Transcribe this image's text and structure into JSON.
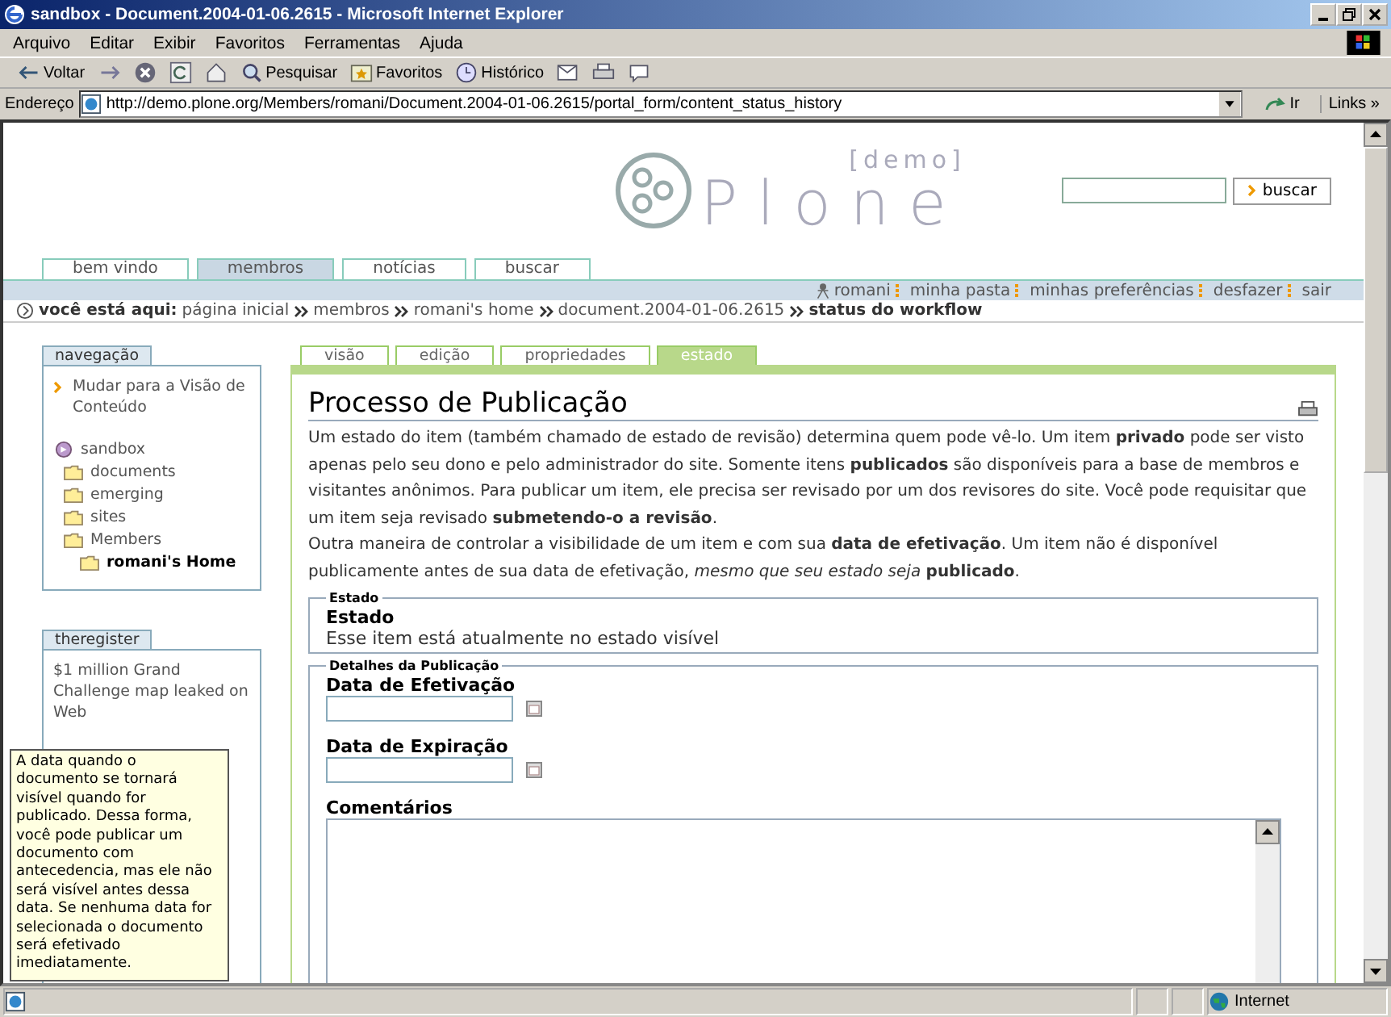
{
  "window": {
    "title": "sandbox - Document.2004-01-06.2615 - Microsoft Internet Explorer"
  },
  "menu": [
    "Arquivo",
    "Editar",
    "Exibir",
    "Favoritos",
    "Ferramentas",
    "Ajuda"
  ],
  "toolbar": [
    {
      "kind": "back",
      "label": "Voltar"
    },
    {
      "kind": "forward"
    },
    {
      "kind": "stop"
    },
    {
      "kind": "refresh"
    },
    {
      "kind": "home"
    },
    {
      "kind": "search",
      "label": "Pesquisar"
    },
    {
      "kind": "favorites",
      "label": "Favoritos"
    },
    {
      "kind": "history",
      "label": "Histórico"
    },
    {
      "kind": "mail"
    },
    {
      "kind": "print"
    },
    {
      "kind": "discuss"
    }
  ],
  "address": {
    "label": "Endereço",
    "url": "http://demo.plone.org/Members/romani/Document.2004-01-06.2615/portal_form/content_status_history",
    "go": "Ir",
    "links": "Links »"
  },
  "logo": {
    "tag": "[demo]",
    "name": "Plone"
  },
  "search": {
    "button": "buscar"
  },
  "site_tabs": [
    {
      "label": "bem vindo",
      "selected": false
    },
    {
      "label": "membros",
      "selected": true
    },
    {
      "label": "notícias",
      "selected": false
    },
    {
      "label": "buscar",
      "selected": false
    }
  ],
  "personal_bar": [
    "romani",
    "minha pasta",
    "minhas preferências",
    "desfazer",
    "sair"
  ],
  "breadcrumb": {
    "label": "você está aqui:",
    "items": [
      "página inicial",
      "membros",
      "romani's home",
      "document.2004-01-06.2615",
      "status do workflow"
    ]
  },
  "navigation": {
    "title": "navegação",
    "switch": "Mudar para a Visão de Conteúdo",
    "tree": [
      {
        "label": "sandbox",
        "kind": "root",
        "selected": false,
        "children": [
          {
            "label": "documents",
            "kind": "folder",
            "selected": false
          },
          {
            "label": "emerging",
            "kind": "folder",
            "selected": false
          },
          {
            "label": "sites",
            "kind": "folder",
            "selected": false
          },
          {
            "label": "Members",
            "kind": "folder",
            "selected": false,
            "children": [
              {
                "label": "romani's Home",
                "kind": "folder",
                "selected": true
              }
            ]
          }
        ]
      }
    ]
  },
  "news": {
    "title": "theregister",
    "items": [
      "$1 million Grand Challenge map leaked on Web"
    ]
  },
  "tooltip": "A data quando o documento se tornará visível quando for publicado. Dessa forma, você pode publicar um documento com antecedencia, mas ele não será visível antes dessa data. Se nenhuma data for selecionada o documento será efetivado imediatamente.",
  "content_tabs": [
    {
      "label": "visão",
      "selected": false
    },
    {
      "label": "edição",
      "selected": false
    },
    {
      "label": "propriedades",
      "selected": false
    },
    {
      "label": "estado",
      "selected": true
    }
  ],
  "heading": "Processo de Publicação",
  "paragraphs": [
    "Um estado do item (também chamado de estado de revisão) determina quem pode vê-lo. Um item **privado** pode ser visto apenas pelo seu dono e pelo administrador do site. Somente itens **publicados** são disponíveis para a base de membros e visitantes anônimos. Para publicar um item, ele precisa ser revisado por um dos revisores do site. Você pode requisitar que um item seja revisado **submetendo-o a revisão**.",
    "Outra maneira de controlar a visibilidade de um item e com sua **data de efetivação**. Um item não é disponível publicamente antes de sua data de efetivação, *mesmo que seu estado seja* **publicado**."
  ],
  "state_fieldset": {
    "legend": "Estado",
    "label": "Estado",
    "value": "Esse item está atualmente no estado visível"
  },
  "details_fieldset": {
    "legend": "Detalhes da Publicação",
    "fields": [
      {
        "label": "Data de Efetivação",
        "kind": "date"
      },
      {
        "label": "Data de Expiração",
        "kind": "date"
      },
      {
        "label": "Comentários",
        "kind": "textarea"
      }
    ]
  },
  "status_bar": {
    "zone": "Internet"
  }
}
